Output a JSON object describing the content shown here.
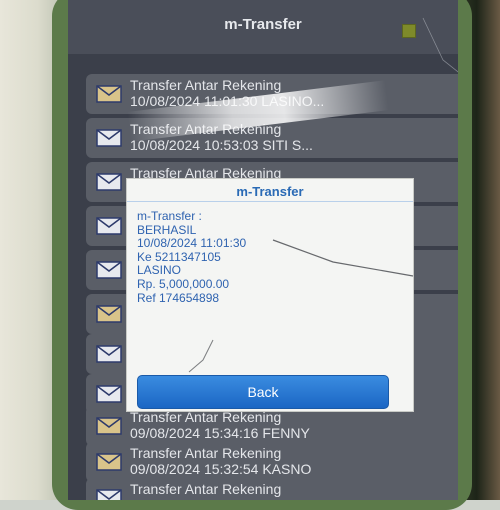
{
  "app": {
    "title": "m-Transfer"
  },
  "list": {
    "items": [
      {
        "line1": "Transfer Antar Rekening",
        "line2": "10/08/2024 11:01:30 LASINO..."
      },
      {
        "line1": "Transfer Antar Rekening",
        "line2": "10/08/2024 10:53:03 SITI S..."
      },
      {
        "line1": "Transfer Antar Rekening",
        "line2": ""
      },
      {
        "line1": "",
        "line2": ""
      },
      {
        "line1": "",
        "line2": ""
      },
      {
        "line1": "",
        "line2": ""
      },
      {
        "line1": "",
        "line2": ""
      },
      {
        "line1": "",
        "line2": ""
      },
      {
        "line1": "Transfer Antar Rekening",
        "line2": "09/08/2024 15:34:16 FENNY"
      },
      {
        "line1": "Transfer Antar Rekening",
        "line2": "09/08/2024 15:32:54 KASNO"
      },
      {
        "line1": "Transfer Antar Rekening",
        "line2": ""
      }
    ]
  },
  "dialog": {
    "title": "m-Transfer",
    "lines": [
      "m-Transfer :",
      "BERHASIL",
      "10/08/2024 11:01:30",
      "Ke 5211347105",
      "LASINO",
      "Rp. 5,000,000.00",
      "Ref 174654898"
    ],
    "back_label": "Back"
  },
  "colors": {
    "accent": "#2a6ab5",
    "button": "#1b66c4",
    "list_bg": "#5a5e67"
  },
  "icons": {
    "list_item": "envelope-icon",
    "menu": "menu-square-icon"
  }
}
